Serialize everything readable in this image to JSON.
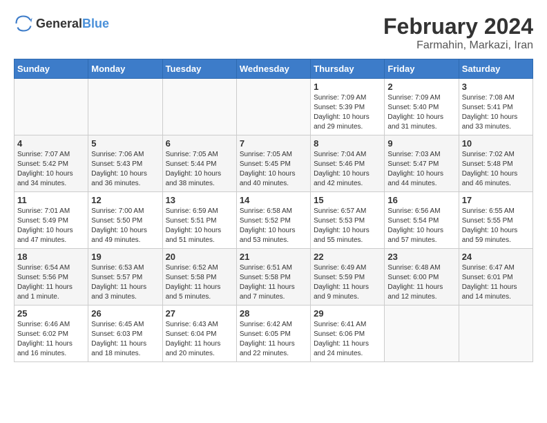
{
  "header": {
    "logo_general": "General",
    "logo_blue": "Blue",
    "month_year": "February 2024",
    "location": "Farmahin, Markazi, Iran"
  },
  "weekdays": [
    "Sunday",
    "Monday",
    "Tuesday",
    "Wednesday",
    "Thursday",
    "Friday",
    "Saturday"
  ],
  "weeks": [
    [
      {
        "day": "",
        "info": ""
      },
      {
        "day": "",
        "info": ""
      },
      {
        "day": "",
        "info": ""
      },
      {
        "day": "",
        "info": ""
      },
      {
        "day": "1",
        "info": "Sunrise: 7:09 AM\nSunset: 5:39 PM\nDaylight: 10 hours\nand 29 minutes."
      },
      {
        "day": "2",
        "info": "Sunrise: 7:09 AM\nSunset: 5:40 PM\nDaylight: 10 hours\nand 31 minutes."
      },
      {
        "day": "3",
        "info": "Sunrise: 7:08 AM\nSunset: 5:41 PM\nDaylight: 10 hours\nand 33 minutes."
      }
    ],
    [
      {
        "day": "4",
        "info": "Sunrise: 7:07 AM\nSunset: 5:42 PM\nDaylight: 10 hours\nand 34 minutes."
      },
      {
        "day": "5",
        "info": "Sunrise: 7:06 AM\nSunset: 5:43 PM\nDaylight: 10 hours\nand 36 minutes."
      },
      {
        "day": "6",
        "info": "Sunrise: 7:05 AM\nSunset: 5:44 PM\nDaylight: 10 hours\nand 38 minutes."
      },
      {
        "day": "7",
        "info": "Sunrise: 7:05 AM\nSunset: 5:45 PM\nDaylight: 10 hours\nand 40 minutes."
      },
      {
        "day": "8",
        "info": "Sunrise: 7:04 AM\nSunset: 5:46 PM\nDaylight: 10 hours\nand 42 minutes."
      },
      {
        "day": "9",
        "info": "Sunrise: 7:03 AM\nSunset: 5:47 PM\nDaylight: 10 hours\nand 44 minutes."
      },
      {
        "day": "10",
        "info": "Sunrise: 7:02 AM\nSunset: 5:48 PM\nDaylight: 10 hours\nand 46 minutes."
      }
    ],
    [
      {
        "day": "11",
        "info": "Sunrise: 7:01 AM\nSunset: 5:49 PM\nDaylight: 10 hours\nand 47 minutes."
      },
      {
        "day": "12",
        "info": "Sunrise: 7:00 AM\nSunset: 5:50 PM\nDaylight: 10 hours\nand 49 minutes."
      },
      {
        "day": "13",
        "info": "Sunrise: 6:59 AM\nSunset: 5:51 PM\nDaylight: 10 hours\nand 51 minutes."
      },
      {
        "day": "14",
        "info": "Sunrise: 6:58 AM\nSunset: 5:52 PM\nDaylight: 10 hours\nand 53 minutes."
      },
      {
        "day": "15",
        "info": "Sunrise: 6:57 AM\nSunset: 5:53 PM\nDaylight: 10 hours\nand 55 minutes."
      },
      {
        "day": "16",
        "info": "Sunrise: 6:56 AM\nSunset: 5:54 PM\nDaylight: 10 hours\nand 57 minutes."
      },
      {
        "day": "17",
        "info": "Sunrise: 6:55 AM\nSunset: 5:55 PM\nDaylight: 10 hours\nand 59 minutes."
      }
    ],
    [
      {
        "day": "18",
        "info": "Sunrise: 6:54 AM\nSunset: 5:56 PM\nDaylight: 11 hours\nand 1 minute."
      },
      {
        "day": "19",
        "info": "Sunrise: 6:53 AM\nSunset: 5:57 PM\nDaylight: 11 hours\nand 3 minutes."
      },
      {
        "day": "20",
        "info": "Sunrise: 6:52 AM\nSunset: 5:58 PM\nDaylight: 11 hours\nand 5 minutes."
      },
      {
        "day": "21",
        "info": "Sunrise: 6:51 AM\nSunset: 5:58 PM\nDaylight: 11 hours\nand 7 minutes."
      },
      {
        "day": "22",
        "info": "Sunrise: 6:49 AM\nSunset: 5:59 PM\nDaylight: 11 hours\nand 9 minutes."
      },
      {
        "day": "23",
        "info": "Sunrise: 6:48 AM\nSunset: 6:00 PM\nDaylight: 11 hours\nand 12 minutes."
      },
      {
        "day": "24",
        "info": "Sunrise: 6:47 AM\nSunset: 6:01 PM\nDaylight: 11 hours\nand 14 minutes."
      }
    ],
    [
      {
        "day": "25",
        "info": "Sunrise: 6:46 AM\nSunset: 6:02 PM\nDaylight: 11 hours\nand 16 minutes."
      },
      {
        "day": "26",
        "info": "Sunrise: 6:45 AM\nSunset: 6:03 PM\nDaylight: 11 hours\nand 18 minutes."
      },
      {
        "day": "27",
        "info": "Sunrise: 6:43 AM\nSunset: 6:04 PM\nDaylight: 11 hours\nand 20 minutes."
      },
      {
        "day": "28",
        "info": "Sunrise: 6:42 AM\nSunset: 6:05 PM\nDaylight: 11 hours\nand 22 minutes."
      },
      {
        "day": "29",
        "info": "Sunrise: 6:41 AM\nSunset: 6:06 PM\nDaylight: 11 hours\nand 24 minutes."
      },
      {
        "day": "",
        "info": ""
      },
      {
        "day": "",
        "info": ""
      }
    ]
  ]
}
